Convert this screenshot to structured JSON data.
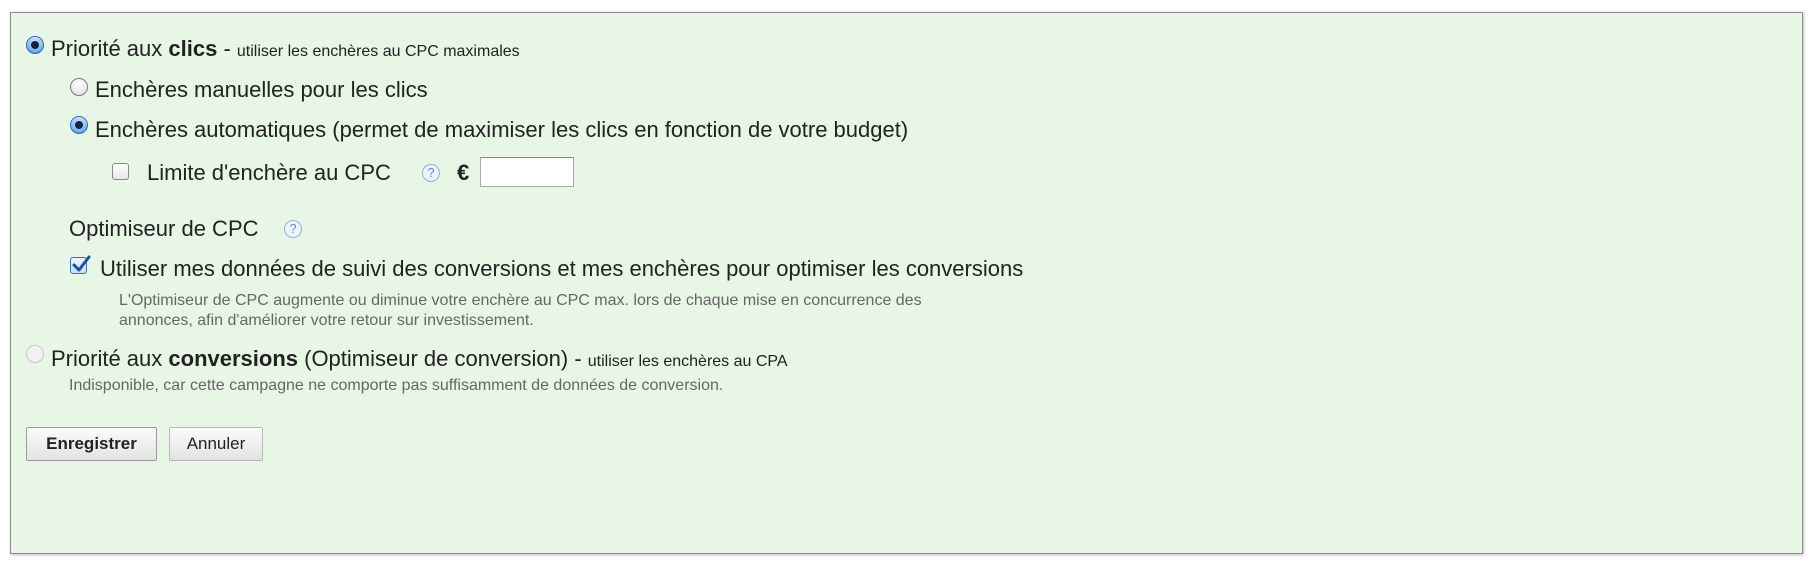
{
  "options": {
    "clicks": {
      "prefix": "Priorité aux ",
      "bold": "clics",
      "suffix": " - ",
      "small": "utiliser les enchères au CPC maximales",
      "selected": true
    },
    "manual": {
      "label": "Enchères manuelles pour les clics",
      "selected": false
    },
    "automatic": {
      "label": "Enchères automatiques (permet de maximiser les clics en fonction de votre budget)",
      "selected": true
    },
    "cpc_limit": {
      "label": "Limite d'enchère au CPC",
      "currency": "€",
      "value": "",
      "checked": false
    },
    "optimizer": {
      "title": "Optimiseur de CPC",
      "checkbox_label": "Utiliser mes données de suivi des conversions et mes enchères pour optimiser les conversions",
      "checked": true,
      "desc_line1": "L'Optimiseur de CPC augmente ou diminue votre enchère au CPC max. lors de chaque mise en concurrence des",
      "desc_line2": "annonces, afin d'améliorer votre retour sur investissement."
    },
    "conversions": {
      "prefix": "Priorité aux ",
      "bold": "conversions",
      "suffix": " (Optimiseur de conversion) - ",
      "small": "utiliser les enchères au CPA",
      "selected": false,
      "disabled": true,
      "note": "Indisponible, car cette campagne ne comporte pas suffisamment de données de conversion."
    }
  },
  "help_glyph": "?",
  "buttons": {
    "save": "Enregistrer",
    "cancel": "Annuler"
  },
  "colors": {
    "panel_bg": "#e8f6e6",
    "radio_selected": "#3b7fd1"
  }
}
